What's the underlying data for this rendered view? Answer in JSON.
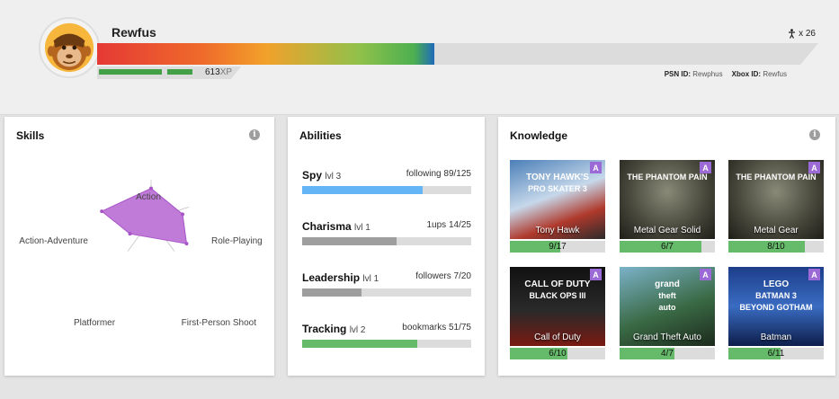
{
  "profile": {
    "username": "Rewfus",
    "xp_value": "613",
    "xp_unit": "XP",
    "xp_progress": 0.467,
    "level_count": "x 26",
    "psn_label": "PSN ID:",
    "psn_value": "Rewphus",
    "xbox_label": "Xbox ID:",
    "xbox_value": "Rewfus",
    "icons": {
      "avatar": "monkey-avatar",
      "level": "person-icon"
    }
  },
  "skills": {
    "title": "Skills",
    "info_icon": "info-icon",
    "accent_color": "#c07ad8",
    "axes": [
      {
        "label": "Action",
        "value": 0.43
      },
      {
        "label": "Role-Playing",
        "value": 0.23
      },
      {
        "label": "First-Person Shoot",
        "value": 0.42
      },
      {
        "label": "Platformer",
        "value": 0.25
      },
      {
        "label": "Action-Adventure",
        "value": 0.36
      }
    ]
  },
  "abilities": {
    "title": "Abilities",
    "items": [
      {
        "name": "Spy",
        "level": "lvl 3",
        "stat_label": "following",
        "stat_value": "89/125",
        "progress": 0.712,
        "color": "#64b5f6"
      },
      {
        "name": "Charisma",
        "level": "lvl 1",
        "stat_label": "1ups",
        "stat_value": "14/25",
        "progress": 0.56,
        "color": "#9e9e9e"
      },
      {
        "name": "Leadership",
        "level": "lvl 1",
        "stat_label": "followers",
        "stat_value": "7/20",
        "progress": 0.35,
        "color": "#9e9e9e"
      },
      {
        "name": "Tracking",
        "level": "lvl 2",
        "stat_label": "bookmarks",
        "stat_value": "51/75",
        "progress": 0.68,
        "color": "#66bb6a"
      }
    ]
  },
  "knowledge": {
    "title": "Knowledge",
    "info_icon": "info-icon",
    "badge": "A",
    "badge_color": "#9c6ad6",
    "progress_color": "#66bb6a",
    "games": [
      {
        "name": "Tony Hawk",
        "progress_text": "9/17",
        "progress": 0.529,
        "art_text": [
          "TONY HAWK'S",
          "PRO SKATER 3"
        ]
      },
      {
        "name": "Metal Gear Solid",
        "progress_text": "6/7",
        "progress": 0.857,
        "art_text": [
          "THE PHANTOM PAIN"
        ]
      },
      {
        "name": "Metal Gear",
        "progress_text": "8/10",
        "progress": 0.8,
        "art_text": [
          "THE PHANTOM PAIN"
        ]
      },
      {
        "name": "Call of Duty",
        "progress_text": "6/10",
        "progress": 0.6,
        "art_text": [
          "CALL OF DUTY",
          "BLACK OPS III"
        ]
      },
      {
        "name": "Grand Theft Auto",
        "progress_text": "4/7",
        "progress": 0.571,
        "art_text": [
          "grand",
          "theft",
          "auto"
        ]
      },
      {
        "name": "Batman",
        "progress_text": "6/11",
        "progress": 0.545,
        "art_text": [
          "LEGO",
          "BATMAN 3",
          "BEYOND GOTHAM"
        ]
      }
    ]
  }
}
